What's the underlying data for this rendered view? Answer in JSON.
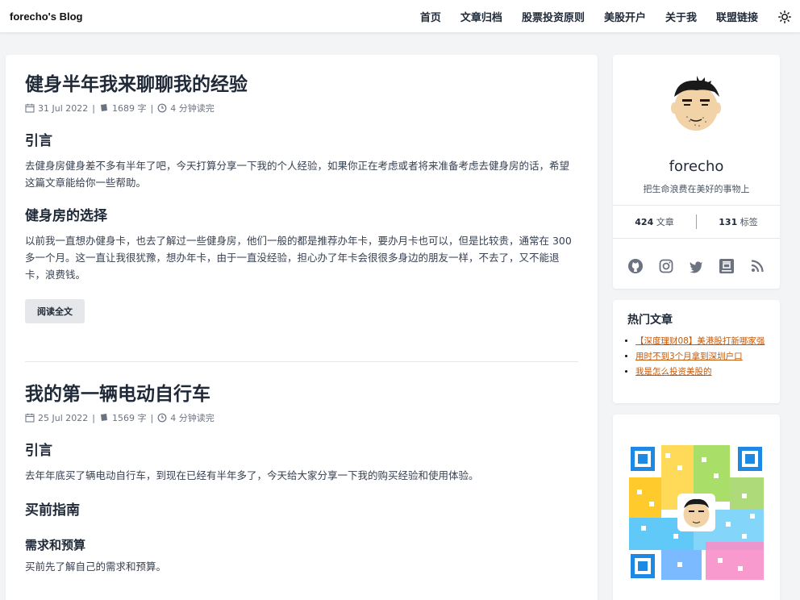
{
  "header": {
    "site_title": "forecho's Blog",
    "nav": [
      "首页",
      "文章归档",
      "股票投资原则",
      "美股开户",
      "关于我",
      "联盟链接"
    ],
    "theme_icon": "sun-icon"
  },
  "posts": [
    {
      "title": "健身半年我来聊聊我的经验",
      "date": "31 Jul 2022",
      "words": "1689 字",
      "read_time": "4 分钟读完",
      "sections": [
        {
          "heading": "引言",
          "text": "去健身房健身差不多有半年了吧，今天打算分享一下我的个人经验，如果你正在考虑或者将来准备考虑去健身房的话，希望这篇文章能给你一些帮助。"
        },
        {
          "heading": "健身房的选择",
          "text": "以前我一直想办健身卡，也去了解过一些健身房，他们一般的都是推荐办年卡，要办月卡也可以，但是比较贵，通常在 300 多一个月。这一直让我很犹豫，想办年卡，由于一直没经验，担心办了年卡会很很多身边的朋友一样，不去了，又不能退卡，浪费钱。"
        }
      ],
      "read_more": "阅读全文"
    },
    {
      "title": "我的第一辆电动自行车",
      "date": "25 Jul 2022",
      "words": "1569 字",
      "read_time": "4 分钟读完",
      "sections": [
        {
          "heading": "引言",
          "text": "去年年底买了辆电动自行车，到现在已经有半年多了，今天给大家分享一下我的购买经验和使用体验。"
        },
        {
          "heading": "买前指南",
          "text": ""
        },
        {
          "heading": "需求和预算",
          "text": "买前先了解自己的需求和预算。"
        }
      ]
    }
  ],
  "profile": {
    "name": "forecho",
    "bio": "把生命浪费在美好的事物上",
    "articles_count": "424",
    "articles_label": "文章",
    "tags_count": "131",
    "tags_label": "标签",
    "social_icons": [
      "github-icon",
      "instagram-icon",
      "twitter-icon",
      "douban-icon",
      "rss-icon"
    ]
  },
  "hot": {
    "title": "热门文章",
    "items": [
      "【深度理财08】美港股打新哪家强",
      "用时不到3个月拿到深圳户口",
      "我是怎么投资美股的"
    ]
  },
  "colors": {
    "link": "#c2590c",
    "page_bg": "#f3f4f6"
  }
}
